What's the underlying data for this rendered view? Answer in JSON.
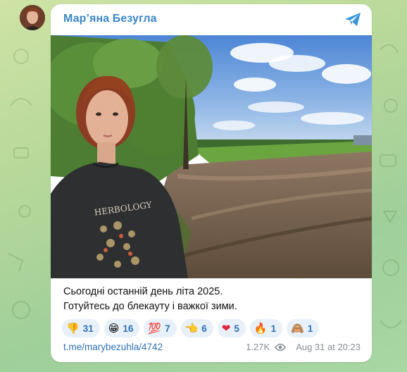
{
  "post": {
    "channel_name": "Мар’яна Безугла",
    "caption_lines": [
      "Сьогодні останній день літа 2025.",
      "Готуйтесь до блекауту і важкої зими."
    ],
    "link": "t.me/marybezuhla/4742",
    "views": "1.27K",
    "timestamp": "Aug 31 at 20:23"
  },
  "reactions": [
    {
      "icon": "thumbs-down",
      "emoji": "👎",
      "count": "31"
    },
    {
      "icon": "grinning-face",
      "emoji": "😁",
      "count": "16"
    },
    {
      "icon": "hundred-points",
      "emoji": "💯",
      "count": "7"
    },
    {
      "icon": "pointing-hand",
      "emoji": "👈",
      "count": "6"
    },
    {
      "icon": "red-heart",
      "emoji": "❤",
      "count": "5"
    },
    {
      "icon": "fire",
      "emoji": "🔥",
      "count": "1"
    },
    {
      "icon": "see-no-evil-monkey",
      "emoji": "🙈",
      "count": "1"
    }
  ],
  "photo": {
    "shirt_text": "HERBOLOGY"
  },
  "colors": {
    "accent": "#3a86c8",
    "reaction_bg": "#e8f0fa",
    "link": "#2f72b6"
  }
}
